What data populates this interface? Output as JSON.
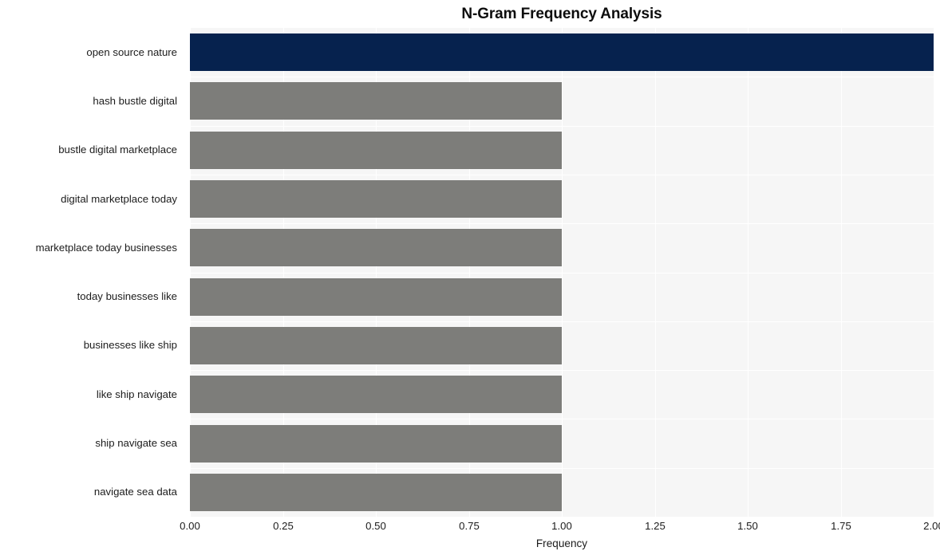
{
  "chart_data": {
    "type": "bar",
    "orientation": "horizontal",
    "title": "N-Gram Frequency Analysis",
    "xlabel": "Frequency",
    "ylabel": "",
    "categories": [
      "open source nature",
      "hash bustle digital",
      "bustle digital marketplace",
      "digital marketplace today",
      "marketplace today businesses",
      "today businesses like",
      "businesses like ship",
      "like ship navigate",
      "ship navigate sea",
      "navigate sea data"
    ],
    "values": [
      2,
      1,
      1,
      1,
      1,
      1,
      1,
      1,
      1,
      1
    ],
    "bar_colors": [
      "#06224e",
      "#7d7d7a",
      "#7d7d7a",
      "#7d7d7a",
      "#7d7d7a",
      "#7d7d7a",
      "#7d7d7a",
      "#7d7d7a",
      "#7d7d7a",
      "#7d7d7a"
    ],
    "xlim": [
      0,
      2.0
    ],
    "xticks": [
      "0.00",
      "0.25",
      "0.50",
      "0.75",
      "1.00",
      "1.25",
      "1.50",
      "1.75",
      "2.00"
    ],
    "xtick_values": [
      0,
      0.25,
      0.5,
      0.75,
      1.0,
      1.25,
      1.5,
      1.75,
      2.0
    ],
    "grid": true,
    "grid_color": "#ffffff",
    "plot_background": "#f6f6f6",
    "figure_background": "#ffffff",
    "legend": null,
    "highlight_color": "#06224e",
    "base_color": "#7d7d7a"
  }
}
